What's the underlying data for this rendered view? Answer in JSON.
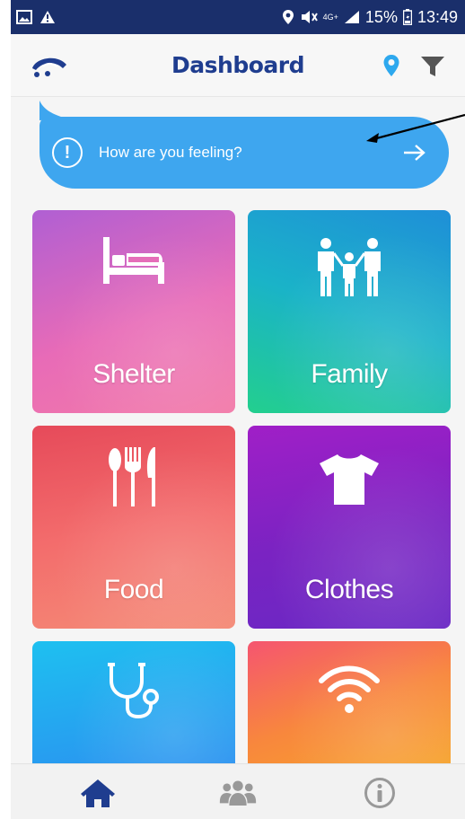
{
  "status_bar": {
    "battery": "15%",
    "time": "13:49",
    "network": "4G+",
    "icons": [
      "image-icon",
      "warning-icon",
      "location-icon",
      "mute-icon",
      "network-icon",
      "signal-icon",
      "battery-icon"
    ]
  },
  "header": {
    "title": "Dashboard",
    "icons": [
      "logo-icon",
      "location-pin-icon",
      "filter-icon"
    ]
  },
  "feeling": {
    "text": "How are you feeling?",
    "icons": [
      "exclamation-icon",
      "arrow-right-icon"
    ]
  },
  "tiles": [
    {
      "label": "Shelter",
      "icon": "bed-icon"
    },
    {
      "label": "Family",
      "icon": "family-icon"
    },
    {
      "label": "Food",
      "icon": "cutlery-icon"
    },
    {
      "label": "Clothes",
      "icon": "tshirt-icon"
    },
    {
      "label": "",
      "icon": "stethoscope-icon"
    },
    {
      "label": "",
      "icon": "wifi-icon"
    }
  ],
  "bottom_nav": {
    "items": [
      "home-icon",
      "people-icon",
      "info-icon"
    ],
    "active": "home-icon"
  },
  "colors": {
    "status_bar": "#1a2f6b",
    "title": "#1f3d8f",
    "bubble": "#3ea6ef",
    "nav_active": "#1f3d8f",
    "nav_inactive": "#999999"
  }
}
